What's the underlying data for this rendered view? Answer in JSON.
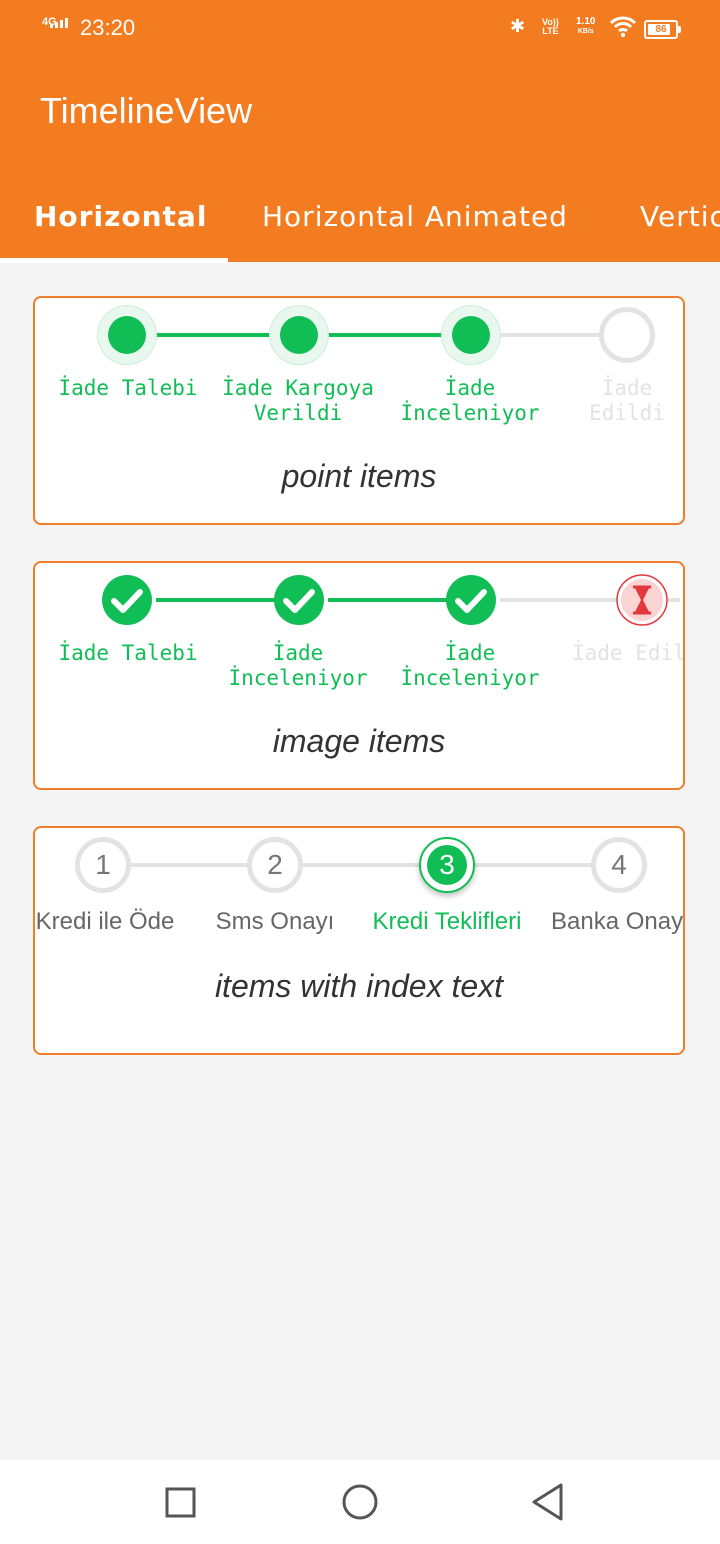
{
  "status_bar": {
    "network": "4G",
    "time": "23:20",
    "volte_top": "Vo))",
    "volte_bottom": "LTE",
    "speed_value": "1.10",
    "speed_unit": "KB/s",
    "battery": "86",
    "battery_level": 0.86
  },
  "app_bar": {
    "title": "TimelineView"
  },
  "tabs": [
    {
      "label": "Horizontal"
    },
    {
      "label": "Horizontal Animated"
    },
    {
      "label": "Vertical"
    }
  ],
  "cards": [
    {
      "caption": "point items",
      "steps": [
        {
          "label_line1": "İade Talebi",
          "label_line2": "",
          "state": "done"
        },
        {
          "label_line1": "İade Kargoya",
          "label_line2": "Verildi",
          "state": "done"
        },
        {
          "label_line1": "İade",
          "label_line2": "İnceleniyor",
          "state": "done"
        },
        {
          "label_line1": "İade",
          "label_line2": "Edildi",
          "state": "todo"
        }
      ]
    },
    {
      "caption": "image items",
      "steps": [
        {
          "label_line1": "İade Talebi",
          "label_line2": "",
          "state": "done",
          "icon": "check-icon"
        },
        {
          "label_line1": "İade",
          "label_line2": "İnceleniyor",
          "state": "done",
          "icon": "check-icon"
        },
        {
          "label_line1": "İade",
          "label_line2": "İnceleniyor",
          "state": "done",
          "icon": "check-icon"
        },
        {
          "label_line1": "İade Edildi",
          "label_line2": "",
          "state": "pending",
          "icon": "hourglass-icon"
        }
      ]
    },
    {
      "caption": "items with index text",
      "steps": [
        {
          "index": "1",
          "label": "Kredi ile Öde",
          "state": "todo"
        },
        {
          "index": "2",
          "label": "Sms Onayı",
          "state": "todo"
        },
        {
          "index": "3",
          "label": "Kredi Teklifleri",
          "state": "current"
        },
        {
          "index": "4",
          "label": "Banka Onayı",
          "state": "todo"
        }
      ]
    }
  ],
  "colors": {
    "primary": "#f27c1f",
    "done_green": "#11be55",
    "inactive_grey": "#e3e3e3",
    "pending_red": "#e2383b"
  },
  "nav_bar": {
    "icons": [
      "recent-apps-icon",
      "home-icon",
      "back-icon"
    ]
  }
}
